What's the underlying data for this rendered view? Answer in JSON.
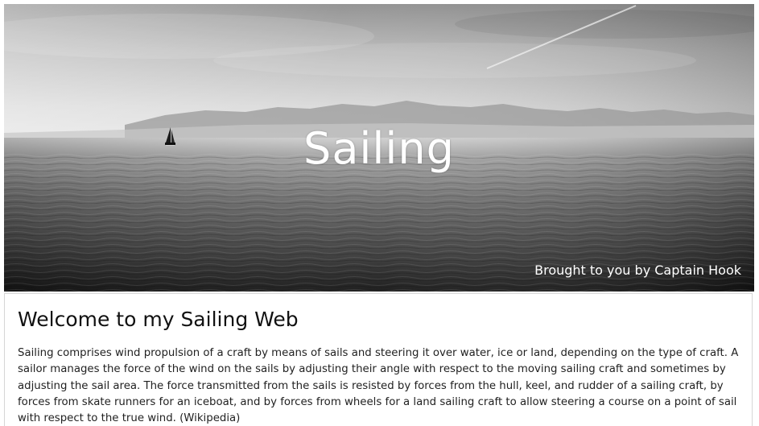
{
  "hero": {
    "title": "Sailing",
    "byline": "Brought to you by Captain Hook",
    "image_icon": "sailboat-seascape-image"
  },
  "main": {
    "heading": "Welcome to my Sailing Web",
    "paragraph": "Sailing comprises wind propulsion of a craft by means of sails and steering it over water, ice or land, depending on the type of craft. A sailor manages the force of the wind on the sails by adjusting their angle with respect to the moving sailing craft and sometimes by adjusting the sail area. The force transmitted from the sails is resisted by forces from the hull, keel, and rudder of a sailing craft, by forces from skate runners for an iceboat, and by forces from wheels for a land sailing craft to allow steering a course on a point of sail with respect to the true wind. (Wikipedia)"
  }
}
